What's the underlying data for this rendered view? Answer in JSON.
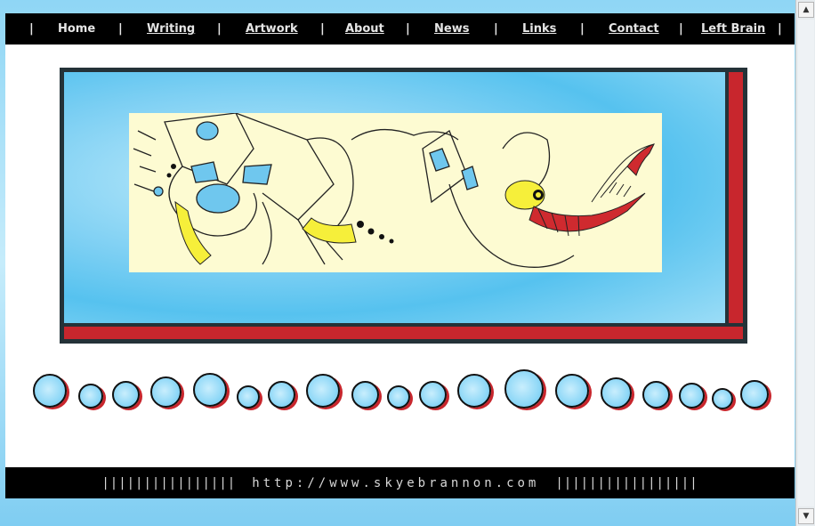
{
  "nav": {
    "items": [
      {
        "label": "Home"
      },
      {
        "label": "Writing"
      },
      {
        "label": "Artwork"
      },
      {
        "label": "About"
      },
      {
        "label": "News"
      },
      {
        "label": "Links"
      },
      {
        "label": "Contact"
      },
      {
        "label": "Left Brain"
      }
    ],
    "separator": "|"
  },
  "footer": {
    "bars_left": "||||||||||||||||",
    "url": "http://www.skyebrannon.com",
    "bars_right": "|||||||||||||||||"
  },
  "colors": {
    "nav_bg": "#000000",
    "accent_red": "#c8262d",
    "frame_border": "#243238",
    "sky_blue": "#7ccff3",
    "art_bg": "#fdfbd2"
  },
  "icons": {
    "bubbles": "bubble-icon",
    "scroll_up": "arrow-up-icon",
    "scroll_down": "arrow-down-icon"
  }
}
